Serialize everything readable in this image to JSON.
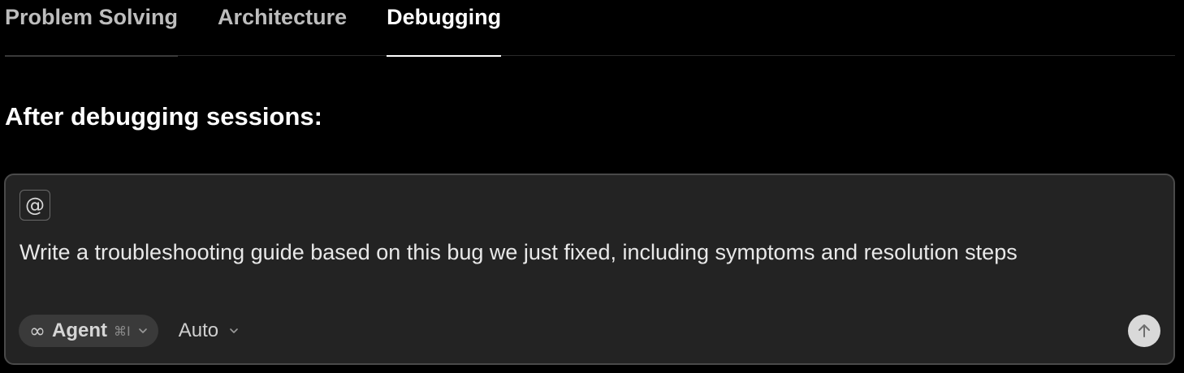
{
  "tabs": [
    {
      "label": "Problem Solving",
      "active": false
    },
    {
      "label": "Architecture",
      "active": false
    },
    {
      "label": "Debugging",
      "active": true
    }
  ],
  "heading": "After debugging sessions:",
  "composer": {
    "mention_icon": "at-icon",
    "mention_symbol": "@",
    "prompt_text": "Write a troubleshooting guide based on this bug we just fixed, including symptoms and resolution steps",
    "mode": {
      "icon": "infinity-icon",
      "icon_symbol": "∞",
      "label": "Agent",
      "shortcut": "⌘I"
    },
    "model": {
      "label": "Auto"
    },
    "send_icon": "arrow-up-icon"
  },
  "colors": {
    "background": "#000000",
    "composer_bg": "#232323",
    "active_tab": "#ffffff",
    "inactive_tab": "#bdbdbd",
    "send_button": "#d9d9d9"
  }
}
